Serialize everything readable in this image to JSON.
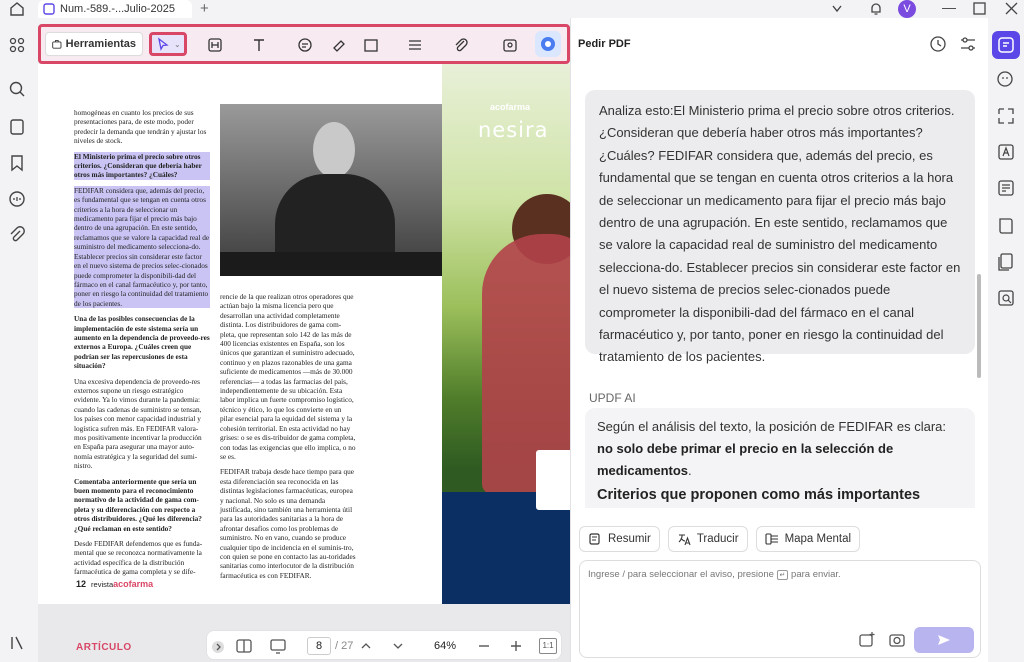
{
  "tab": {
    "title": "Num.-589.-...Julio-2025"
  },
  "titlebar": {
    "avatar_letter": "V"
  },
  "toolbar": {
    "tools_label": "Herramientas"
  },
  "doc": {
    "left_col_intro": "homogéneas en cuanto los precios de sus presentaciones para, de este modo, poder predecir la demanda que tendrán y ajustar los niveles de stock.",
    "q1": "El Ministerio prima el precio sobre otros criterios. ¿Consideran que debería haber otros más importantes? ¿Cuáles?",
    "a1": "FEDIFAR considera que, además del precio, es fundamental que se tengan en cuenta otros criterios a la hora de seleccionar un medicamento para fijar el precio más bajo dentro de una agrupación. En este sentido, reclamamos que se valore la capacidad real de suministro del medicamento selecciona-do. Establecer precios sin considerar este factor en el nuevo sistema de precios selec-cionados puede comprometer la disponibili-dad del fármaco en el canal farmacéutico y, por tanto, poner en riesgo la continuidad del tratamiento de los pacientes.",
    "q2": "Una de las posibles consecuencias de la implementación de este sistema sería un aumento en la dependencia de proveedo-res externos a Europa. ¿Cuáles creen que podrían ser las repercusiones de esta situación?",
    "a2": "Una excesiva dependencia de proveedo-res externos supone un riesgo estratégico evidente. Ya lo vimos durante la pandemia: cuando las cadenas de suministro se tensan, los países con menor capacidad industrial y logística sufren más. En FEDIFAR valora-mos positivamente incentivar la producción en España para asegurar una mayor auto-nomía estratégica y la seguridad del sumi-nistro.",
    "q3": "Comentaba anteriormente que sería un buen momento para el reconocimiento normativo de la actividad de gama com-pleta y su diferenciación con respecto a otros distribuidores. ¿Qué les diferencia? ¿Qué reclaman en este sentido?",
    "a3": "Desde FEDIFAR defendemos que es funda-mental que se reconozca normativamente la actividad específica de la distribución farmacéutica de gama completa y se dife-",
    "mid_col_1": "rencie de la que realizan otros operadores que actúan bajo la misma licencia pero que desarrollan una actividad completamente distinta. Los distribuidores de gama com-pleta, que representan solo 142 de las más de 400 licencias existentes en España, son los únicos que garantizan el suministro adecuado, continuo y en plazos razonables de una gama suficiente de medicamentos —más de 30.000 referencias— a todas las farmacias del país, independientemente de su ubicación. Esta labor implica un fuerte compromiso logístico, técnico y ético, lo que los convierte en un pilar esencial para la equidad del sistema y la cohesión territorial. En esta actividad no hay grises: o se es dis-tribuidor de gama completa, con todas las exigencias que ello implica, o no se es.",
    "mid_col_2": "FEDIFAR trabaja desde hace tiempo para que esta diferenciación sea reconocida en las distintas legislaciones farmacéuticas, europea y nacional. No solo es una demanda justificada, sino también una herramienta útil para las autoridades sanitarias a la hora de afrontar desafíos como los problemas de suministro. No en vano, cuando se produce cualquier tipo de incidencia en el suminis-tro, con quien se pone en contacto las au-toridades sanitarias como interlocutor de la distribución farmacéutica es con FEDIFAR.",
    "page_number": "12",
    "footer_pre": "revista",
    "footer_brand": "acofarma",
    "ad_brand": "acofarma",
    "ad_product": "nesira",
    "section_label": "ARTÍCULO"
  },
  "bottombar": {
    "current_page": "8",
    "total_pages": "/ 27",
    "zoom": "64%",
    "fit_label": "1:1"
  },
  "chat": {
    "title": "Pedir PDF",
    "user_message": "Analiza esto:El Ministerio prima el precio sobre otros criterios. ¿Consideran que debería haber otros más importantes? ¿Cuáles? FEDIFAR considera que, además del precio, es fundamental que se tengan en cuenta otros criterios a la hora de seleccionar un medicamento para fijar el precio más bajo dentro de una agrupación. En este sentido, reclamamos que se valore la capacidad real de suministro del medicamento selecciona-do. Establecer precios sin considerar este factor en el nuevo sistema de precios selec-cionados puede comprometer la disponibili-dad del fármaco en el canal farmacéutico y, por tanto, poner en riesgo la continuidad del tratamiento de los pacientes.",
    "ai_label": "UPDF AI",
    "ai_intro": "Según el análisis del texto, la posición de FEDIFAR es clara: ",
    "ai_bold": "no solo debe primar el precio en la selección de medicamentos",
    "ai_end": ".",
    "ai_heading": "Criterios que proponen como más importantes",
    "chips": [
      "Resumir",
      "Traducir",
      "Mapa Mental"
    ],
    "input_placeholder_a": "Ingrese / para seleccionar el aviso, presione",
    "input_placeholder_b": "para enviar."
  },
  "colors": {
    "accent": "#5b47e8",
    "highlight": "#d94766",
    "selection": "#c9c4f4"
  }
}
